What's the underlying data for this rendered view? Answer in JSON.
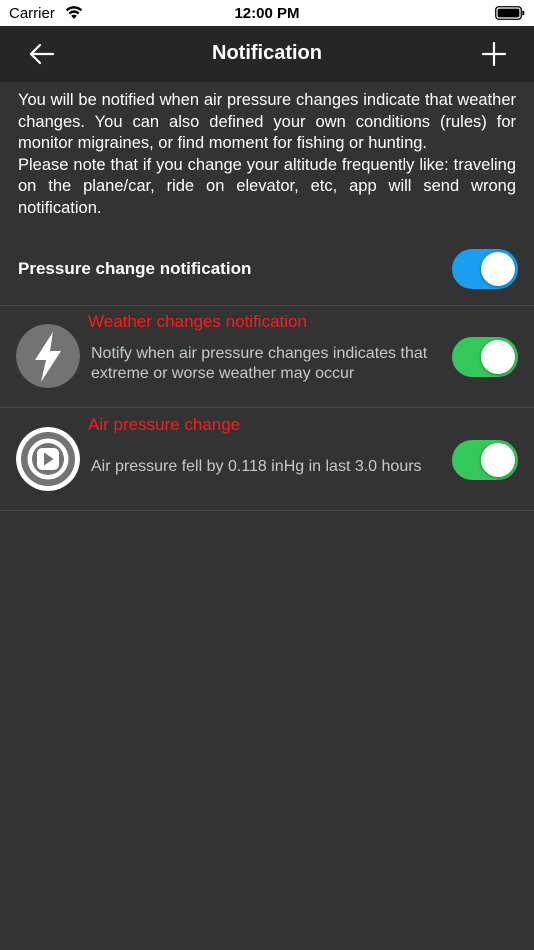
{
  "status_bar": {
    "carrier": "Carrier",
    "time": "12:00 PM",
    "wifi_icon": "wifi-icon",
    "battery_icon": "battery-icon"
  },
  "nav": {
    "title": "Notification",
    "back_icon": "arrow-left-icon",
    "add_icon": "plus-icon"
  },
  "intro": {
    "paragraph1": "You will be notified when air pressure changes indicate that weather changes. You can also defined your own conditions (rules) for monitor migraines, or find moment for fishing or hunting.",
    "paragraph2": "Please note that if you change your altitude frequently like: traveling on the plane/car, ride on elevator, etc, app will send wrong notification."
  },
  "pressure_change": {
    "label": "Pressure change notification",
    "enabled": true,
    "toggle_color": "#1a9ff0"
  },
  "items": [
    {
      "title": "Weather changes notification",
      "description": "Notify when air pressure changes indicates that extreme or worse weather may occur",
      "icon": "lightning-icon",
      "enabled": true
    },
    {
      "title": "Air pressure change",
      "description": "Air pressure fell by 0.118 inHg in last 3.0 hours",
      "icon": "gauge-icon",
      "enabled": true
    }
  ],
  "colors": {
    "background": "#333333",
    "nav_background": "#262626",
    "title_red": "#ff1a1a",
    "toggle_green": "#34c759"
  }
}
